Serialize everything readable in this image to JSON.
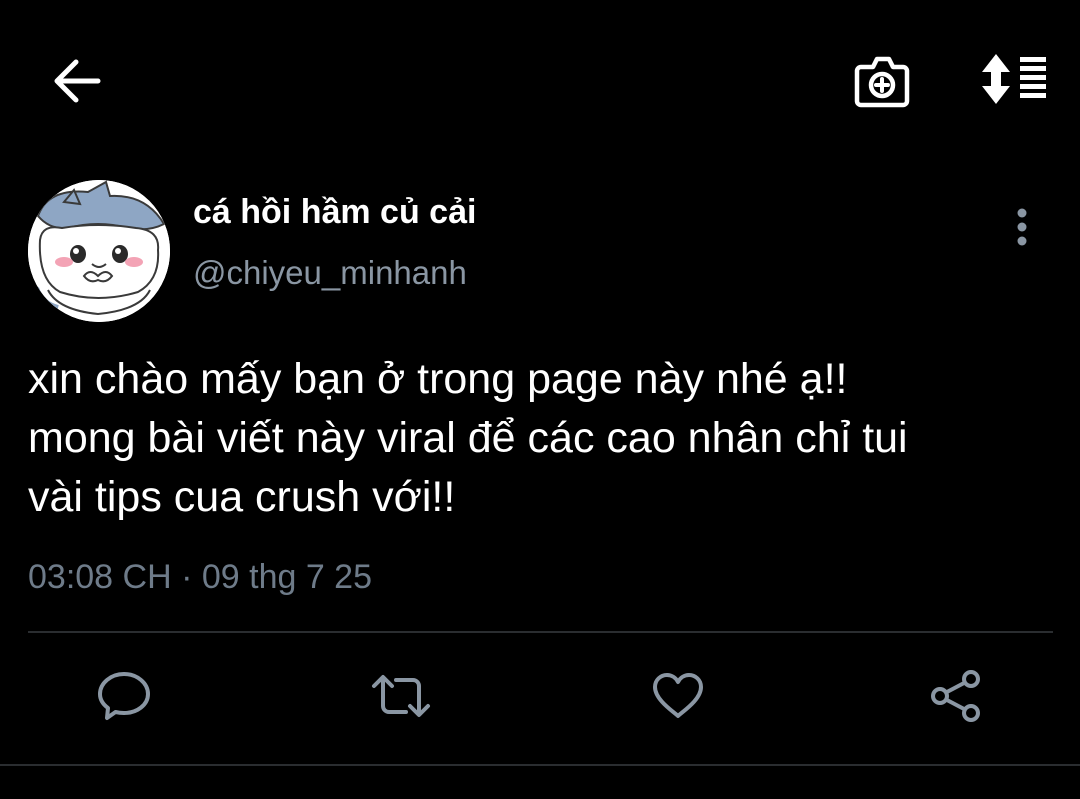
{
  "header": {
    "back_icon": "arrow-left-icon",
    "camera_icon": "camera-add-icon",
    "sort_icon": "sort-list-icon"
  },
  "author": {
    "display_name": "cá hồi hầm củ cải",
    "handle": "@chiyeu_minhanh",
    "avatar_icon": "chiikawa-avatar"
  },
  "tweet": {
    "lines": [
      "xin chào mấy bạn ở trong page này nhé ạ!!",
      "mong bài viết này viral để các cao nhân chỉ tui",
      "vài tips cua crush với!!"
    ],
    "timestamp": "03:08 CH · 09 thg 7 25"
  },
  "actions": {
    "reply_icon": "reply-bubble-icon",
    "retweet_icon": "retweet-icon",
    "like_icon": "heart-icon",
    "share_icon": "share-icon"
  },
  "colors": {
    "background": "#000000",
    "primary_text": "#ffffff",
    "secondary_text": "#8a96a3",
    "timestamp_text": "#6e7b89",
    "icon_gray": "#8a96a3",
    "divider": "#2a2d30"
  }
}
